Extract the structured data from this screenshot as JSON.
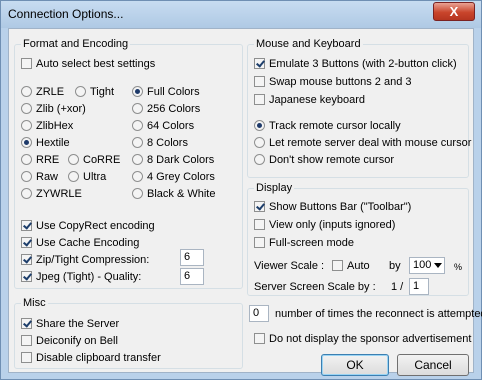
{
  "window": {
    "title": "Connection Options...",
    "close_glyph": "X"
  },
  "format": {
    "legend": "Format and Encoding",
    "auto_select": {
      "label": "Auto select best settings",
      "checked": false
    },
    "encodings": [
      {
        "label": "ZRLE",
        "selected": false
      },
      {
        "label": "Zlib (+xor)",
        "selected": false
      },
      {
        "label": "ZlibHex",
        "selected": false
      },
      {
        "label": "Hextile",
        "selected": true
      },
      {
        "label": "RRE",
        "selected": false
      },
      {
        "label": "Raw",
        "selected": false
      },
      {
        "label": "ZYWRLE",
        "selected": false
      }
    ],
    "encodings_extra": [
      {
        "label": "Tight",
        "selected": false
      },
      {
        "label": "CoRRE",
        "selected": false
      },
      {
        "label": "Ultra",
        "selected": false
      }
    ],
    "colors": [
      {
        "label": "Full Colors",
        "selected": true
      },
      {
        "label": "256 Colors",
        "selected": false
      },
      {
        "label": "64 Colors",
        "selected": false
      },
      {
        "label": "8 Colors",
        "selected": false
      },
      {
        "label": "8 Dark Colors",
        "selected": false
      },
      {
        "label": "4 Grey Colors",
        "selected": false
      },
      {
        "label": "Black & White",
        "selected": false
      }
    ],
    "use_copyrect": {
      "label": "Use CopyRect encoding",
      "checked": true
    },
    "use_cache": {
      "label": "Use Cache Encoding",
      "checked": true
    },
    "zip_compression": {
      "label": "Zip/Tight Compression:",
      "checked": true,
      "value": "6"
    },
    "jpeg_quality": {
      "label": "Jpeg (Tight) - Quality:",
      "checked": true,
      "value": "6"
    }
  },
  "misc": {
    "legend": "Misc",
    "share_server": {
      "label": "Share the Server",
      "checked": true
    },
    "deiconify": {
      "label": "Deiconify on Bell",
      "checked": false
    },
    "disable_clipboard": {
      "label": "Disable clipboard transfer",
      "checked": false
    }
  },
  "mouse": {
    "legend": "Mouse and Keyboard",
    "emulate3": {
      "label": "Emulate 3 Buttons (with 2-button click)",
      "checked": true
    },
    "swap_buttons": {
      "label": "Swap mouse buttons 2 and 3",
      "checked": false
    },
    "japanese_kb": {
      "label": "Japanese keyboard",
      "checked": false
    },
    "cursor_options": [
      {
        "label": "Track remote cursor locally",
        "selected": true
      },
      {
        "label": "Let remote server deal with mouse cursor",
        "selected": false
      },
      {
        "label": "Don't show remote cursor",
        "selected": false
      }
    ]
  },
  "display": {
    "legend": "Display",
    "show_toolbar": {
      "label": "Show Buttons Bar (\"Toolbar\")",
      "checked": true
    },
    "view_only": {
      "label": "View only (inputs ignored)",
      "checked": false
    },
    "fullscreen": {
      "label": "Full-screen mode",
      "checked": false
    },
    "viewer_scale_label": "Viewer Scale :",
    "auto_label": "Auto",
    "auto_checked": false,
    "by_label": "by",
    "scale_value": "100",
    "percent": "%",
    "server_scale_label": "Server Screen Scale by :",
    "server_scale_prefix": "1  /",
    "server_scale_value": "1"
  },
  "reconnect": {
    "value": "0",
    "label": "number of times the reconnect is attempted"
  },
  "sponsor": {
    "label": "Do not display the sponsor advertisement",
    "checked": false
  },
  "buttons": {
    "ok": "OK",
    "cancel": "Cancel"
  }
}
